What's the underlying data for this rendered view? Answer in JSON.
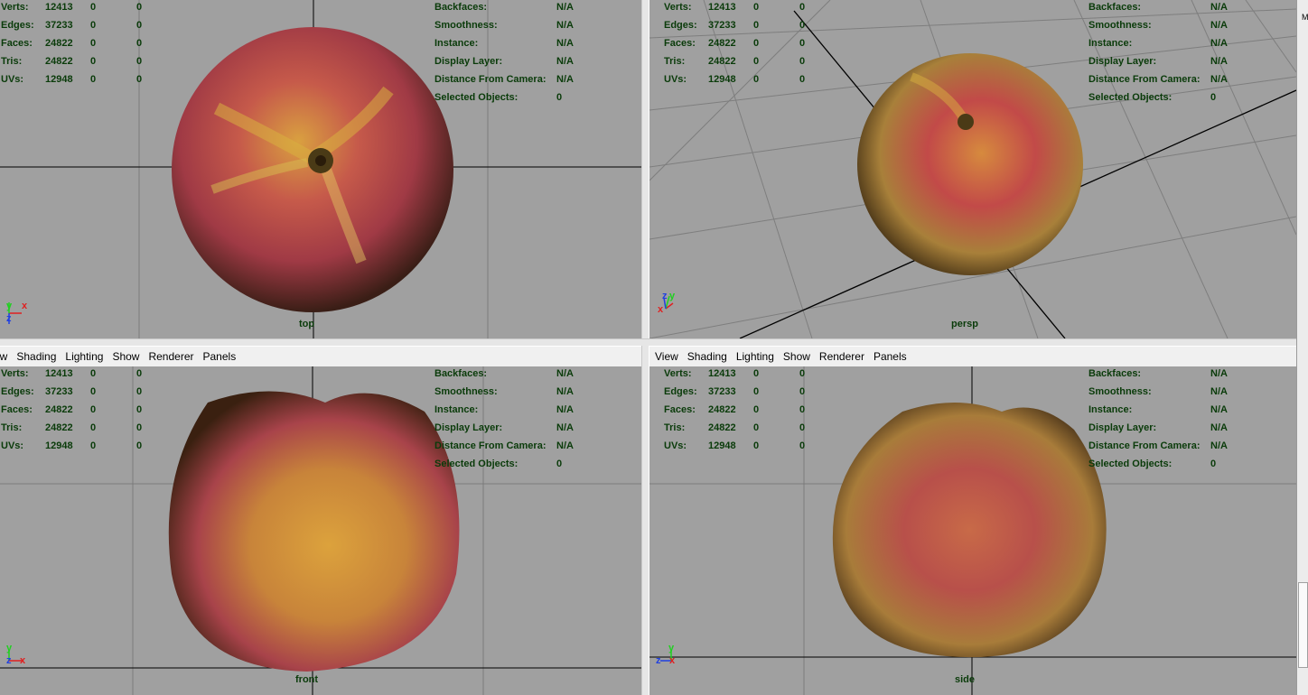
{
  "menu": [
    "View",
    "Shading",
    "Lighting",
    "Show",
    "Renderer",
    "Panels"
  ],
  "menu_left_partial": [
    "ew",
    "Shading",
    "Lighting",
    "Show",
    "Renderer",
    "Panels"
  ],
  "side_panel_letter": "M",
  "stats": [
    {
      "label": "Verts:",
      "v1": "12413",
      "v2": "0",
      "v3": "0"
    },
    {
      "label": "Edges:",
      "v1": "37233",
      "v2": "0",
      "v3": "0"
    },
    {
      "label": "Faces:",
      "v1": "24822",
      "v2": "0",
      "v3": "0"
    },
    {
      "label": "Tris:",
      "v1": "24822",
      "v2": "0",
      "v3": "0"
    },
    {
      "label": "UVs:",
      "v1": "12948",
      "v2": "0",
      "v3": "0"
    }
  ],
  "info": [
    {
      "label": "Backfaces:",
      "value": "N/A"
    },
    {
      "label": "Smoothness:",
      "value": "N/A"
    },
    {
      "label": "Instance:",
      "value": "N/A"
    },
    {
      "label": "Display Layer:",
      "value": "N/A"
    },
    {
      "label": "Distance From Camera:",
      "value": "N/A"
    },
    {
      "label": "Selected Objects:",
      "value": "0"
    }
  ],
  "viewports": {
    "top": {
      "camera": "top",
      "axes": [
        "y",
        "x",
        "z"
      ]
    },
    "persp": {
      "camera": "persp",
      "axes": [
        "z",
        "y",
        "x"
      ]
    },
    "front": {
      "camera": "front",
      "axes": [
        "y",
        "z",
        "x"
      ]
    },
    "side": {
      "camera": "side",
      "axes": [
        "y",
        "z",
        "x"
      ]
    }
  },
  "colors": {
    "viewport_bg": "#a0a0a0",
    "hud_text": "#0a3b0a",
    "axis_x": "#e02020",
    "axis_y": "#20d020",
    "axis_z": "#2040e0"
  }
}
